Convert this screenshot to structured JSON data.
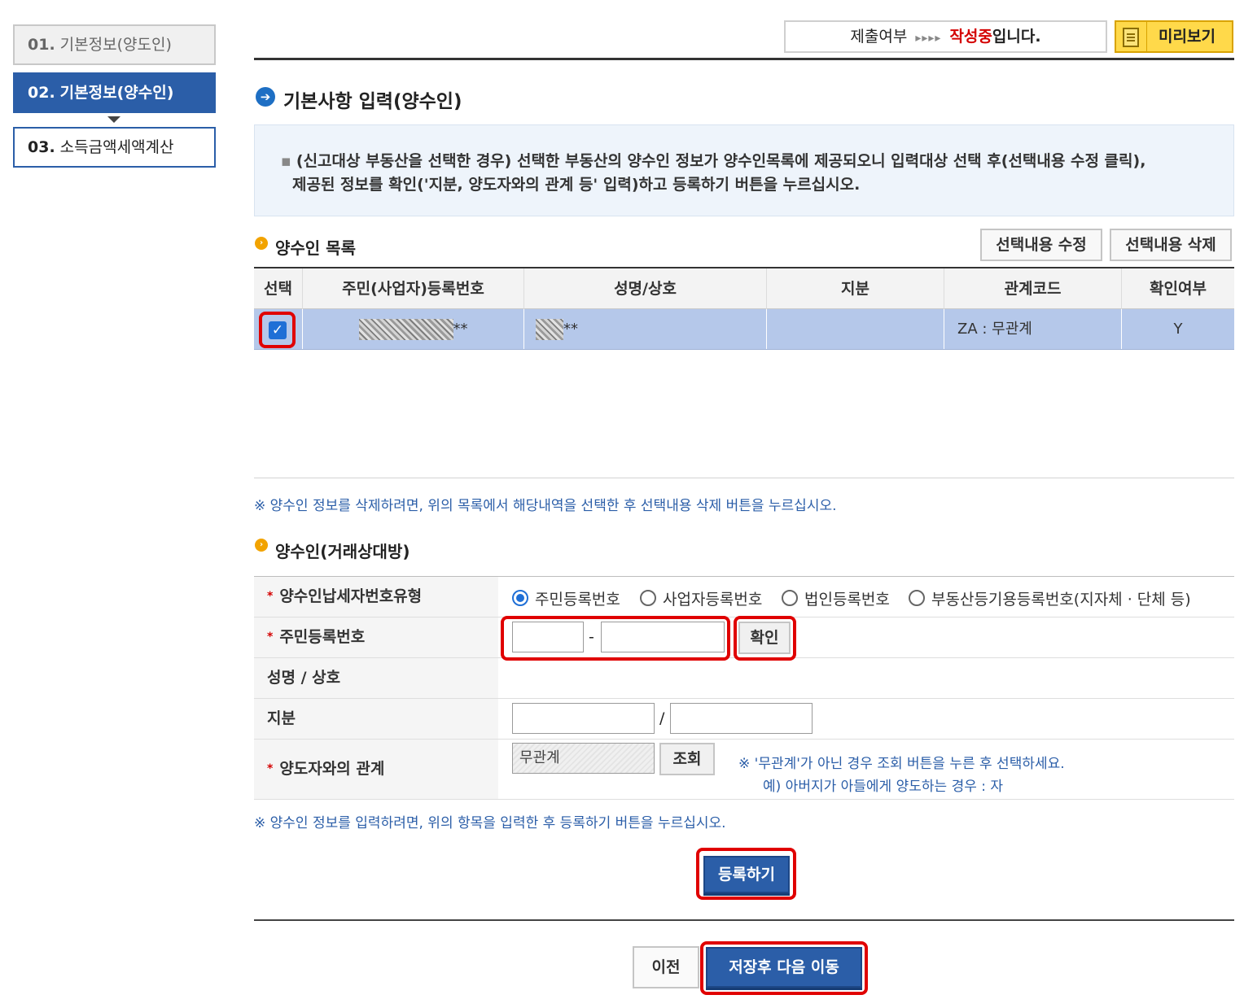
{
  "steps": [
    {
      "num": "01.",
      "label": "기본정보(양도인)"
    },
    {
      "num": "02.",
      "label": "기본정보(양수인)"
    },
    {
      "num": "03.",
      "label": "소득금액세액계산"
    }
  ],
  "status": {
    "label": "제출여부",
    "arrows": "▸▸▸▸",
    "state": "작성중",
    "suffix": "입니다.",
    "preview_label": "미리보기"
  },
  "section": {
    "title": "기본사항 입력(양수인)",
    "info_line1": "(신고대상 부동산을 선택한 경우) 선택한 부동산의 양수인 정보가 양수인목록에 제공되오니 입력대상 선택 후(선택내용 수정 클릭),",
    "info_line2": "제공된 정보를 확인('지분, 양도자와의 관계 등' 입력)하고 등록하기 버튼을 누르십시오."
  },
  "list": {
    "title": "양수인 목록",
    "edit_button": "선택내용 수정",
    "delete_button": "선택내용 삭제",
    "headers": [
      "선택",
      "주민(사업자)등록번호",
      "성명/상호",
      "지분",
      "관계코드",
      "확인여부"
    ],
    "rows": [
      {
        "checked": true,
        "id_suffix": "**",
        "name_suffix": "**",
        "share": "",
        "relation": "ZA : 무관계",
        "confirmed": "Y"
      }
    ],
    "delete_note": "※ 양수인 정보를 삭제하려면, 위의 목록에서 해당내역을 선택한 후 선택내용 삭제 버튼을 누르십시오."
  },
  "form": {
    "title": "양수인(거래상대방)",
    "type_label": "양수인납세자번호유형",
    "type_options": [
      "주민등록번호",
      "사업자등록번호",
      "법인등록번호",
      "부동산등기용등록번호(지자체 · 단체 등)"
    ],
    "type_selected": "주민등록번호",
    "rrn_label": "주민등록번호",
    "rrn_front": "",
    "rrn_dash": "-",
    "rrn_back": "",
    "confirm_button": "확인",
    "name_label": "성명 / 상호",
    "name_value": "",
    "share_label": "지분",
    "share_num": "",
    "share_slash": "/",
    "share_den": "",
    "relation_label": "양도자와의 관계",
    "relation_value": "무관계",
    "lookup_button": "조회",
    "relation_note1": "※ '무관계'가 아닌 경우 조회 버튼을 누른 후 선택하세요.",
    "relation_note2": "예) 아버지가 아들에게 양도하는 경우 : 자",
    "input_note": "※ 양수인 정보를 입력하려면, 위의 항목을 입력한 후 등록하기 버튼을 누르십시오.",
    "register_button": "등록하기"
  },
  "footer": {
    "prev_button": "이전",
    "save_next_button": "저장후 다음 이동"
  },
  "colors": {
    "primary": "#2b5ea8",
    "highlight_row": "#b5c8ea",
    "state_red": "#d40000",
    "annotation_red": "#e00000",
    "preview_yellow": "#ffd94a"
  }
}
